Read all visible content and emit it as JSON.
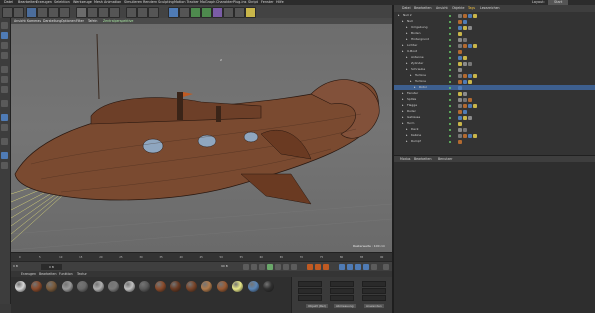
{
  "menubar": {
    "items": [
      "Datei",
      "Bearbeiten",
      "Erzeugen",
      "Selektion",
      "Werkzeuge",
      "Mesh",
      "Animation",
      "Simulieren",
      "Rendern",
      "Sculpting",
      "Motion Tracker",
      "MoGraph",
      "Charakter",
      "Plug-ins",
      "Skript",
      "Fenster",
      "Hilfe"
    ],
    "layout_label": "Layout:",
    "layout_value": "Start"
  },
  "viewport_menu": {
    "items": [
      "Ansicht",
      "Kameras",
      "Darstellung",
      "Optionen",
      "Filter",
      "Tafeln",
      "Zentralperspektive"
    ]
  },
  "viewport": {
    "hud_top": "2",
    "hud_status": "Rasterweite : 100 cm"
  },
  "timeline": {
    "ticks": [
      "0",
      "5",
      "10",
      "15",
      "20",
      "25",
      "30",
      "35",
      "40",
      "45",
      "50",
      "55",
      "60",
      "65",
      "70",
      "75",
      "80",
      "85",
      "90"
    ],
    "frame_left": "0 B",
    "frame_field": "0 B",
    "frame_end": "90 B"
  },
  "material_manager": {
    "tabs": [
      "Erzeugen",
      "Bearbeiten",
      "Funktion",
      "Textur"
    ],
    "materials": [
      {
        "color": "#d8d8d8"
      },
      {
        "color": "#8b4a2a"
      },
      {
        "color": "#7a5a3a"
      },
      {
        "color": "#9a9a9a"
      },
      {
        "color": "#6a6a6a"
      },
      {
        "color": "#b0b0b0"
      },
      {
        "color": "#7a7a7a"
      },
      {
        "color": "#c0c0c0"
      },
      {
        "color": "#5a5a5a"
      },
      {
        "color": "#8a4a2a"
      },
      {
        "color": "#6a3a22"
      },
      {
        "color": "#7a4428"
      },
      {
        "color": "#b07a4a"
      },
      {
        "color": "#9a5a32"
      },
      {
        "color": "#e8e888"
      },
      {
        "color": "#5a86b8"
      },
      {
        "color": "#303030"
      }
    ]
  },
  "coordinates": {
    "world_label": "Objekt (Rel)",
    "size_label": "Abmessung",
    "apply_label": "Anwenden"
  },
  "object_manager": {
    "header": [
      "Datei",
      "Bearbeiten",
      "Ansicht",
      "Objekte",
      "Tags",
      "Lesezeichen"
    ],
    "rows": [
      {
        "label": "Null 2",
        "indent": 1
      },
      {
        "label": "Null",
        "indent": 2
      },
      {
        "label": "Umgebung",
        "indent": 3
      },
      {
        "label": "Boden",
        "indent": 3
      },
      {
        "label": "Hintergrund",
        "indent": 3
      },
      {
        "label": "Lichter",
        "indent": 2
      },
      {
        "label": "U-Boot",
        "indent": 2
      },
      {
        "label": "Antenne",
        "indent": 3
      },
      {
        "label": "Zylinder",
        "indent": 3
      },
      {
        "label": "Schraube",
        "indent": 3
      },
      {
        "label": "Turbine",
        "indent": 4
      },
      {
        "label": "Turbine",
        "indent": 4
      },
      {
        "label": "Rotor",
        "indent": 5
      },
      {
        "label": "Fenster",
        "indent": 2
      },
      {
        "label": "Spitze",
        "indent": 2
      },
      {
        "label": "Flagge",
        "indent": 2
      },
      {
        "label": "Ruder",
        "indent": 2
      },
      {
        "label": "Gehäuse",
        "indent": 2
      },
      {
        "label": "Turm",
        "indent": 2
      },
      {
        "label": "Deck",
        "indent": 3
      },
      {
        "label": "Kabine",
        "indent": 3
      },
      {
        "label": "Rumpf",
        "indent": 3
      }
    ]
  },
  "attribute_manager": {
    "header": [
      "Modus",
      "Bearbeiten",
      "Benutzer"
    ]
  },
  "colors": {
    "hull": "#7a4a30",
    "selection": "#3d5f8f",
    "accent_orange": "#c05a22"
  }
}
